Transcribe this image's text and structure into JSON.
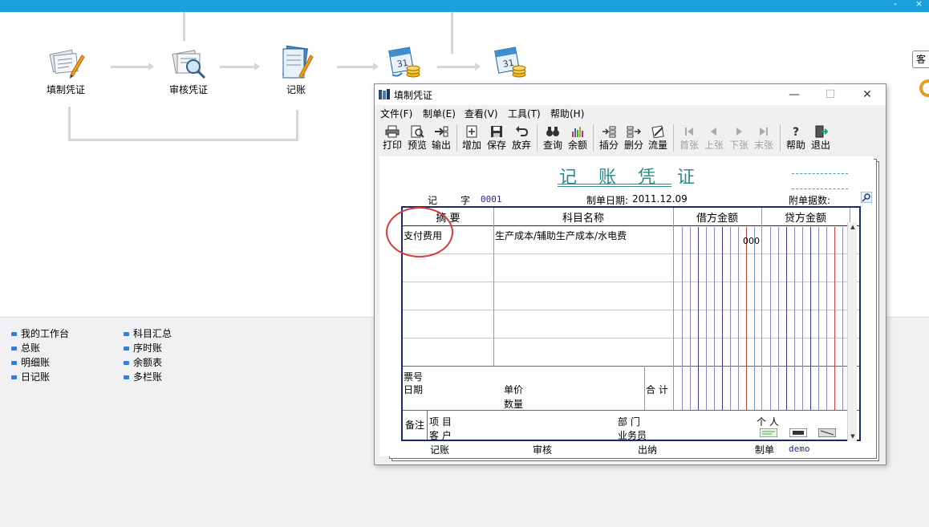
{
  "topbar": {
    "right_glyphs": [
      "-",
      "×"
    ]
  },
  "flow": {
    "nodes": [
      {
        "label": "填制凭证",
        "icon": "voucher-edit-icon"
      },
      {
        "label": "审核凭证",
        "icon": "voucher-review-icon"
      },
      {
        "label": "记账",
        "icon": "post-ledger-icon"
      },
      {
        "label": "",
        "icon": "calendar-coins-icon"
      },
      {
        "label": "",
        "icon": "calendar-coins-icon"
      }
    ]
  },
  "edge_button_label": "客",
  "links": {
    "col1": [
      "我的工作台",
      "总账",
      "明细账",
      "日记账"
    ],
    "col2": [
      "科目汇总",
      "序时账",
      "余额表",
      "多栏账"
    ]
  },
  "dialog": {
    "title": "填制凭证",
    "window_buttons": {
      "min": "—",
      "max": "☐",
      "close": "✕"
    },
    "menu": [
      "文件(F)",
      "制单(E)",
      "查看(V)",
      "工具(T)",
      "帮助(H)"
    ],
    "toolbar": [
      {
        "label": "打印",
        "icon": "print-icon",
        "enabled": true
      },
      {
        "label": "预览",
        "icon": "preview-icon",
        "enabled": true
      },
      {
        "label": "输出",
        "icon": "export-icon",
        "enabled": true
      },
      {
        "label": "增加",
        "icon": "add-icon",
        "enabled": true
      },
      {
        "label": "保存",
        "icon": "save-icon",
        "enabled": true
      },
      {
        "label": "放弃",
        "icon": "undo-icon",
        "enabled": true
      },
      {
        "label": "查询",
        "icon": "binoculars-icon",
        "enabled": true
      },
      {
        "label": "余额",
        "icon": "balance-chart-icon",
        "enabled": true
      },
      {
        "label": "插分",
        "icon": "insert-row-icon",
        "enabled": true
      },
      {
        "label": "删分",
        "icon": "delete-row-icon",
        "enabled": true
      },
      {
        "label": "流量",
        "icon": "cashflow-icon",
        "enabled": true
      },
      {
        "label": "首张",
        "icon": "first-icon",
        "enabled": false
      },
      {
        "label": "上张",
        "icon": "prev-icon",
        "enabled": false
      },
      {
        "label": "下张",
        "icon": "next-icon",
        "enabled": false
      },
      {
        "label": "末张",
        "icon": "last-icon",
        "enabled": false
      },
      {
        "label": "帮助",
        "icon": "help-icon",
        "enabled": true
      },
      {
        "label": "退出",
        "icon": "exit-icon",
        "enabled": true
      }
    ],
    "voucher": {
      "title": "记 账 凭 证",
      "ji_label": "记",
      "zi_label": "字",
      "number": "0001",
      "date_label": "制单日期:",
      "date_value": "2011.12.09",
      "attach_label": "附单据数:",
      "columns": {
        "summary": "摘  要",
        "account": "科目名称",
        "debit": "借方金额",
        "credit": "贷方金额"
      },
      "rows": [
        {
          "summary": "支付费用",
          "account": "生产成本/辅助生产成本/水电费",
          "debit": "000",
          "credit": ""
        },
        {
          "summary": "",
          "account": "",
          "debit": "",
          "credit": ""
        },
        {
          "summary": "",
          "account": "",
          "debit": "",
          "credit": ""
        },
        {
          "summary": "",
          "account": "",
          "debit": "",
          "credit": ""
        },
        {
          "summary": "",
          "account": "",
          "debit": "",
          "credit": ""
        }
      ],
      "footer": {
        "ticket_no": "票号",
        "date": "日期",
        "unit_price": "单价",
        "quantity": "数量",
        "total": "合 计",
        "remark": "备注",
        "project": "项  目",
        "customer": "客  户",
        "department": "部  门",
        "person": "个  人",
        "salesperson": "业务员"
      },
      "signatures": {
        "posting": "记账",
        "review": "审核",
        "cashier": "出纳",
        "maker": "制单",
        "maker_name": "demo"
      }
    }
  },
  "colors": {
    "accent": "#1aa0dc",
    "grid": "#1a2a6e",
    "circle": "#d93a3a",
    "title": "#2c8a8a"
  }
}
